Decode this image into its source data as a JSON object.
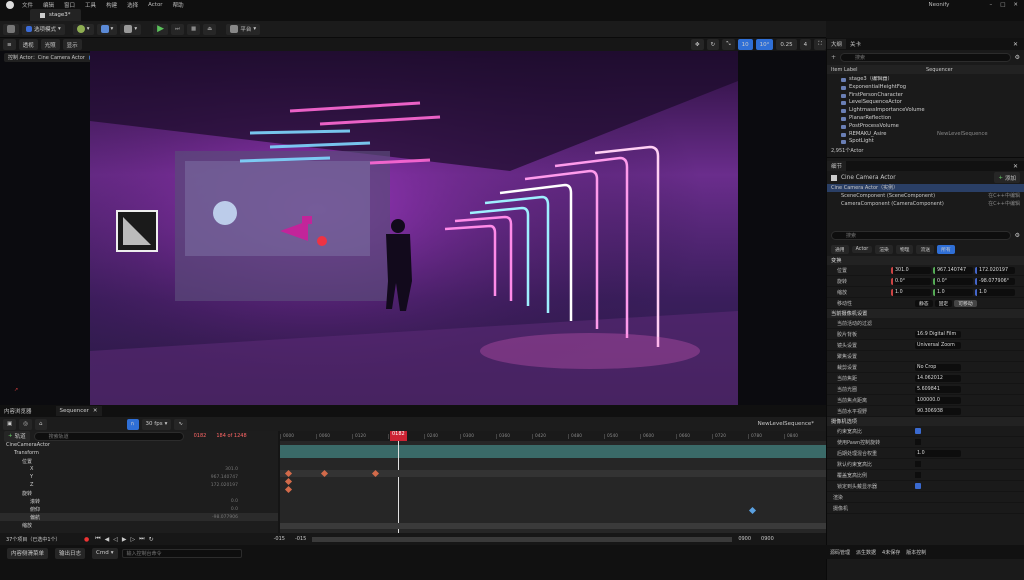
{
  "menu": [
    "文件",
    "编辑",
    "窗口",
    "工具",
    "构建",
    "选择",
    "Actor",
    "帮助"
  ],
  "project_name": "Neonify",
  "doc_tab": "stage3*",
  "toolbar": {
    "mode": "选项模式",
    "platform": "平台"
  },
  "viewport": {
    "perspective": "透视",
    "lit": "光照",
    "show": "显示",
    "pilot_label": "控制 Actor：Cine Camera Actor",
    "snap_grid": "10",
    "snap_rot": "10°",
    "snap_scale": "0.25",
    "cam_speed": "4"
  },
  "outliner": {
    "tabs": [
      "大纲",
      "关卡"
    ],
    "search_placeholder": "搜索",
    "col_label": "Item Label",
    "col_type": "Sequencer",
    "items": [
      {
        "label": "stage3（编辑器）",
        "type": ""
      },
      {
        "label": "ExponentialHeightFog",
        "type": ""
      },
      {
        "label": "FirstPersonCharacter",
        "type": ""
      },
      {
        "label": "LevelSequenceActor",
        "type": ""
      },
      {
        "label": "LightmassImportanceVolume",
        "type": ""
      },
      {
        "label": "PlanarReflection",
        "type": ""
      },
      {
        "label": "PostProcessVolume",
        "type": ""
      },
      {
        "label": "REMAKU_Asire",
        "type": "NewLevelSequence"
      },
      {
        "label": "SpotLight",
        "type": ""
      }
    ],
    "count": "2,951个Actor"
  },
  "details": {
    "tab": "细节",
    "actor_name": "Cine Camera Actor",
    "add": "添加",
    "components": [
      {
        "label": "Cine Camera Actor（实例）",
        "extra": ""
      },
      {
        "label": "SceneComponent (SceneComponent)",
        "extra": "在C++中编辑"
      },
      {
        "label": "CameraComponent (CameraComponent)",
        "extra": "在C++中编辑"
      }
    ],
    "search_placeholder": "搜索",
    "filter_tabs": [
      "通用",
      "Actor",
      "渲染",
      "物理",
      "流送",
      "所有"
    ],
    "transform_header": "变换",
    "location_label": "位置",
    "rotation_label": "旋转",
    "scale_label": "缩放",
    "location": [
      "301.0",
      "967.140747",
      "172.020197"
    ],
    "rotation": [
      "0.0°",
      "0.0°",
      "-98.077906°"
    ],
    "scale": [
      "1.0",
      "1.0",
      "1.0"
    ],
    "mobility_label": "移动性",
    "mobility": [
      "静态",
      "固定",
      "可移动"
    ],
    "camera_settings_header": "当前摄像机设置",
    "rows": [
      {
        "label": "当前活动的过滤",
        "value": ""
      },
      {
        "label": "胶片背板",
        "value": "16:9 Digital Film"
      },
      {
        "label": "镜头设置",
        "value": "Universal Zoom"
      },
      {
        "label": "聚焦设置",
        "value": ""
      },
      {
        "label": "裁剪设置",
        "value": "No Crop"
      },
      {
        "label": "当前焦距",
        "value": "14.062012"
      },
      {
        "label": "当前光圈",
        "value": "5.609841"
      },
      {
        "label": "当前焦点距离",
        "value": "100000.0"
      },
      {
        "label": "当前水平视野",
        "value": "90.306938"
      }
    ],
    "scene_header": "摄像机选项",
    "options": [
      {
        "label": "约束宽高比",
        "value": "check"
      },
      {
        "label": "使用Pawn控制旋转",
        "value": ""
      },
      {
        "label": "后期处理混合权重",
        "value": "1.0"
      },
      {
        "label": "默认约束宽高比",
        "value": ""
      },
      {
        "label": "覆盖宽高比例",
        "value": ""
      },
      {
        "label": "锁定到头戴显示器",
        "value": "check"
      }
    ],
    "misc": [
      "渲染",
      "摄像机"
    ]
  },
  "bottom_tabs": [
    "内容浏览器",
    "Sequencer"
  ],
  "sequencer": {
    "add_track": "轨道",
    "search_placeholder": "搜索轨道",
    "frame_current": "0182",
    "frame_total": "184 of 1248",
    "fps": "30 fps",
    "sequence_name": "NewLevelSequence*",
    "ruler": [
      "0000",
      "0060",
      "0120",
      "0180",
      "0240",
      "0300",
      "0360",
      "0420",
      "0480",
      "0540",
      "0600",
      "0660",
      "0720",
      "0780",
      "0840"
    ],
    "tracks": [
      {
        "label": "CineCameraActor",
        "value": "",
        "indent": 0
      },
      {
        "label": "Transform",
        "value": "",
        "indent": 1
      },
      {
        "label": "位置",
        "value": "",
        "indent": 2
      },
      {
        "label": "X",
        "value": "301.0",
        "indent": 3
      },
      {
        "label": "Y",
        "value": "967.140747",
        "indent": 3
      },
      {
        "label": "Z",
        "value": "172.020197",
        "indent": 3
      },
      {
        "label": "旋转",
        "value": "",
        "indent": 2
      },
      {
        "label": "滚转",
        "value": "0.0",
        "indent": 3
      },
      {
        "label": "俯仰",
        "value": "0.0",
        "indent": 3
      },
      {
        "label": "偏航",
        "value": "-98.077906",
        "indent": 3
      },
      {
        "label": "缩放",
        "value": "",
        "indent": 2
      }
    ],
    "footer_count": "37个项目（已选中1个）",
    "range_start": "-015",
    "range_start2": "-015",
    "range_end": "0900",
    "range_end2": "0900"
  },
  "statusbar": {
    "content_drawer": "内容侧滑菜单",
    "output_log": "输出日志",
    "cmd": "Cmd",
    "cmd_placeholder": "输入控制台命令",
    "source_control": "源码管理",
    "derived": "派生数据",
    "unsaved": "4未保存",
    "revision": "版本控制"
  },
  "colors": {
    "accent": "#2f6fd6",
    "key": "#d26a4a",
    "neon_pink": "#ff4fd8",
    "neon_cyan": "#7fe8ff",
    "bg": "#151515"
  }
}
